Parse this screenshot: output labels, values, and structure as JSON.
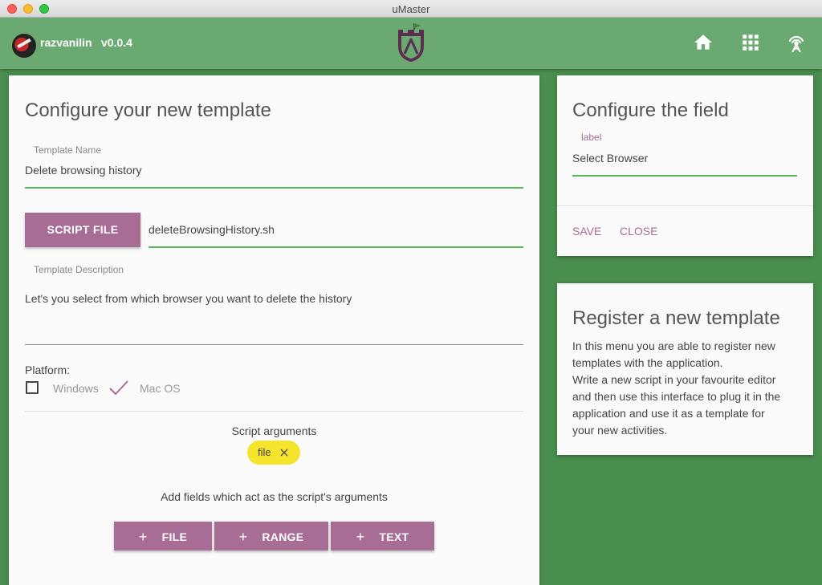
{
  "window": {
    "title": "uMaster"
  },
  "appbar": {
    "username": "razvanilin",
    "version": "v0.0.4",
    "icons": [
      "home-icon",
      "apps-icon",
      "broadcast-icon"
    ],
    "color": "#6aaa72"
  },
  "main": {
    "title": "Configure your new template",
    "template_name": {
      "label": "Template Name",
      "value": "Delete browsing history"
    },
    "script_file": {
      "button": "SCRIPT FILE",
      "value": "deleteBrowsingHistory.sh"
    },
    "description": {
      "label": "Template Description",
      "value": "Let's you select from which browser you want to delete the history"
    },
    "platform": {
      "label": "Platform:",
      "options": [
        {
          "label": "Windows",
          "checked": false
        },
        {
          "label": "Mac OS",
          "checked": true
        }
      ]
    },
    "arguments": {
      "label": "Script arguments",
      "chips": [
        "file"
      ],
      "hint": "Add fields which act as the script's arguments",
      "buttons": [
        "FILE",
        "RANGE",
        "TEXT"
      ]
    }
  },
  "field_config": {
    "title": "Configure the field",
    "label_caption": "label",
    "value": "Select Browser",
    "save": "SAVE",
    "close": "CLOSE"
  },
  "info": {
    "title": "Register a new template",
    "lines": [
      "In this menu you are able to register new",
      "templates with the application.",
      "Write a new script in your favourite editor",
      "and then use this interface to plug it in the",
      "application and use it as a template for",
      "your new activities."
    ]
  },
  "colors": {
    "accent": "#a86d95",
    "success_underline": "#5cb85c",
    "chip": "#f5e42c",
    "background": "#4a8f4e"
  }
}
